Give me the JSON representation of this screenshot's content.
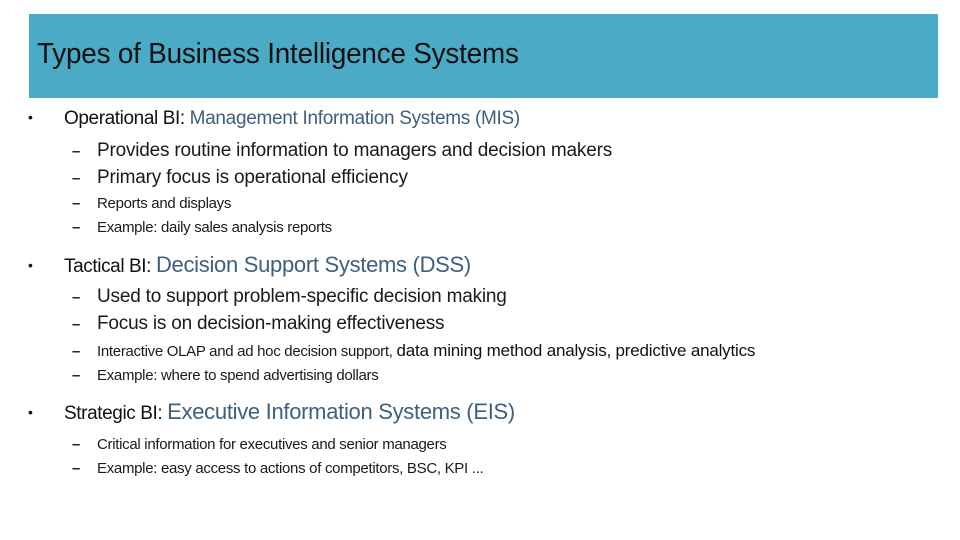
{
  "slide": {
    "title": "Types of Business Intelligence Systems",
    "colors": {
      "banner": "#4BAAC6",
      "accent": "#3E5F7E",
      "text": "#111111"
    },
    "bullet_glyph": "•",
    "dash_glyph": "–",
    "sections": [
      {
        "lead": "Operational BI: ",
        "system": "Management Information Systems (MIS)",
        "items": [
          "Provides routine information to managers and decision makers",
          "Primary focus is operational efficiency",
          "Reports and displays",
          "Example: daily sales analysis reports"
        ]
      },
      {
        "lead": "Tactical BI: ",
        "system": "Decision Support Systems (DSS)",
        "items": [
          "Used to support problem-specific decision making",
          "Focus is on decision-making effectiveness",
          "Interactive OLAP and ad hoc decision support, ",
          "Example: where to spend advertising dollars"
        ],
        "item3_emphasis": "data mining method analysis, predictive analytics"
      },
      {
        "lead": "Strategic BI: ",
        "system": "Executive Information Systems (EIS)",
        "items": [
          "Critical information for executives and senior managers",
          "Example: easy access to actions of competitors, BSC, KPI ..."
        ]
      }
    ]
  }
}
